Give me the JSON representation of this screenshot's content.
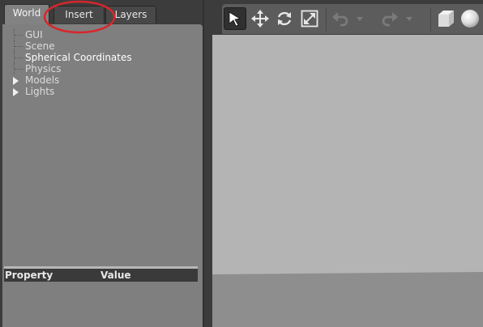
{
  "left_panel": {
    "tabs": [
      {
        "label": "World",
        "active": true
      },
      {
        "label": "Insert",
        "active": false
      },
      {
        "label": "Layers",
        "active": false
      }
    ],
    "tree_items": [
      {
        "label": "GUI",
        "expandable": false
      },
      {
        "label": "Scene",
        "expandable": false
      },
      {
        "label": "Spherical Coordinates",
        "expandable": false
      },
      {
        "label": "Physics",
        "expandable": false
      },
      {
        "label": "Models",
        "expandable": true
      },
      {
        "label": "Lights",
        "expandable": true
      }
    ],
    "property_table": {
      "col_property": "Property",
      "col_value": "Value"
    }
  },
  "toolbar": {
    "tools": [
      {
        "icon": "select-arrow-icon",
        "active": true
      },
      {
        "icon": "translate-icon",
        "active": false
      },
      {
        "icon": "rotate-icon",
        "active": false
      },
      {
        "icon": "scale-icon",
        "active": false
      },
      {
        "icon": "undo-icon",
        "active": false,
        "disabled": true
      },
      {
        "icon": "undo-history-chevron-icon",
        "active": false,
        "disabled": true
      },
      {
        "icon": "redo-icon",
        "active": false,
        "disabled": true
      },
      {
        "icon": "redo-history-chevron-icon",
        "active": false,
        "disabled": true
      },
      {
        "icon": "box-shape-icon",
        "active": false
      },
      {
        "icon": "sphere-shape-icon",
        "active": false
      }
    ]
  },
  "annotation": {
    "color": "#d8262b",
    "target": "Insert tab"
  },
  "colors": {
    "panel_bg": "#7f7f7f",
    "window_bg": "#3c3c3c",
    "viewport_sky": "#b4b4b4",
    "viewport_ground": "#8e8e8e",
    "highlight_text": "#ffffff"
  }
}
